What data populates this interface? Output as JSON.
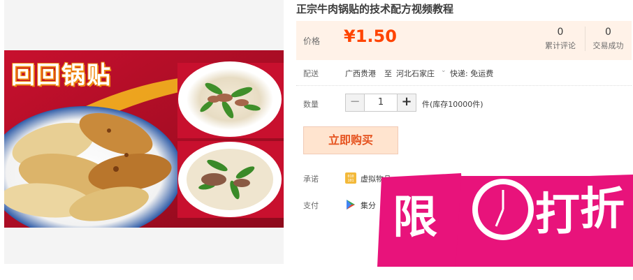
{
  "product": {
    "title": "正宗牛肉锅贴的技术配方视频教程",
    "image_title": "回回锅贴"
  },
  "price": {
    "label": "价格",
    "value": "¥1.50",
    "reviews_count": "0",
    "reviews_label": "累计评论",
    "sales_count": "0",
    "sales_label": "交易成功"
  },
  "delivery": {
    "label": "配送",
    "from": "广西贵港",
    "to_word": "至",
    "destination": "河北石家庄",
    "shipping": "快递: 免运费"
  },
  "quantity": {
    "label": "数量",
    "minus": "−",
    "value": "1",
    "plus": "+",
    "stock": "件(库存10000件)"
  },
  "buy": {
    "label": "立即购买"
  },
  "promise": {
    "label": "承诺",
    "text": "虚拟物品"
  },
  "payment": {
    "label": "支付",
    "text": "集分"
  },
  "badge": {
    "char1": "限",
    "char2": "打",
    "char3": "折"
  },
  "colors": {
    "accent": "#ff4400",
    "badge": "#e8137b",
    "price_bg": "#fff2e8"
  }
}
